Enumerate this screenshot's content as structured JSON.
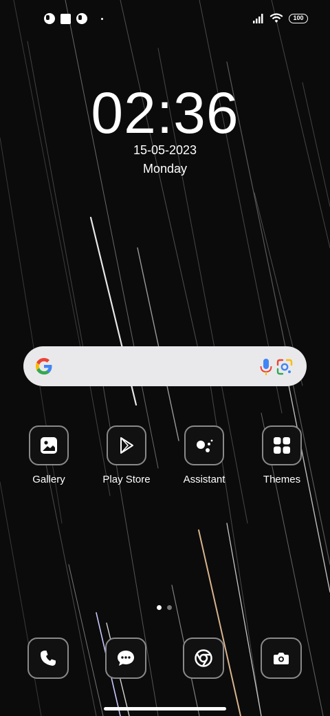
{
  "status_bar": {
    "left_icons": [
      "notification-app-icon",
      "notification-square-icon",
      "notification-app-icon",
      "more-notifications-dot"
    ],
    "signal_icon": "cellular-signal-icon",
    "wifi_icon": "wifi-icon",
    "battery_level": "100"
  },
  "clock": {
    "time": "02:36",
    "date": "15-05-2023",
    "day": "Monday"
  },
  "search": {
    "logo": "google-g-icon",
    "voice_icon": "microphone-icon",
    "lens_icon": "google-lens-icon"
  },
  "apps": [
    {
      "label": "Gallery",
      "icon": "gallery-icon"
    },
    {
      "label": "Play Store",
      "icon": "play-store-icon"
    },
    {
      "label": "Assistant",
      "icon": "assistant-icon"
    },
    {
      "label": "Themes",
      "icon": "themes-icon"
    }
  ],
  "pager": {
    "current_page": 1,
    "total_pages": 2
  },
  "dock": [
    {
      "icon": "phone-icon"
    },
    {
      "icon": "messages-icon"
    },
    {
      "icon": "chrome-icon"
    },
    {
      "icon": "camera-icon"
    }
  ],
  "colors": {
    "icon_border": "#8a8a8a",
    "search_bg": "#e9e9eb",
    "wallpaper": "#0b0b0b"
  }
}
